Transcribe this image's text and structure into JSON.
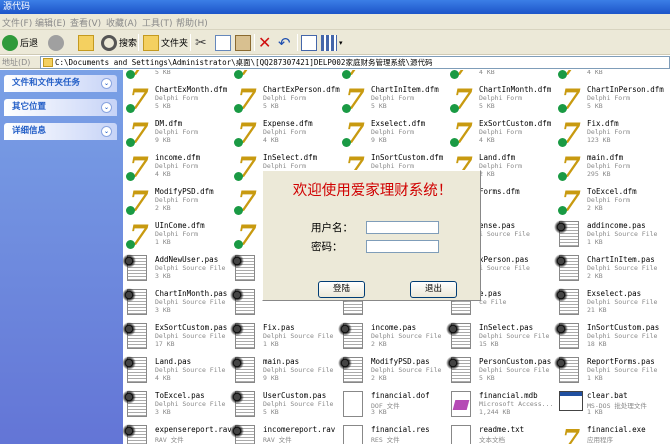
{
  "window": {
    "title": "源代码"
  },
  "menu": [
    "文件(F)",
    "编辑(E)",
    "查看(V)",
    "收藏(A)",
    "工具(T)",
    "帮助(H)"
  ],
  "toolbar": {
    "back": "后退",
    "search": "搜索",
    "folders": "文件夹"
  },
  "address": {
    "label": "地址(D)",
    "path": "C:\\Documents and Settings\\Administrator\\桌面\\[QQ287307421]DELP002家庭财务管理系统\\源代码"
  },
  "sidebar": {
    "panels": [
      {
        "title": "文件和文件夹任务"
      },
      {
        "title": "其它位置"
      },
      {
        "title": "详细信息"
      }
    ]
  },
  "files": [
    {
      "name": "",
      "type": "Delphi Form",
      "size": "5 KB",
      "icon": "delphi-form-icon"
    },
    {
      "name": "",
      "type": "",
      "size": "",
      "icon": "delphi-form-icon"
    },
    {
      "name": "",
      "type": "",
      "size": "",
      "icon": "delphi-form-icon"
    },
    {
      "name": "",
      "type": "",
      "size": "4 KB",
      "icon": "delphi-form-icon"
    },
    {
      "name": "",
      "type": "",
      "size": "4 KB",
      "icon": "delphi-form-icon"
    },
    {
      "name": "ChartExMonth.dfm",
      "type": "Delphi Form",
      "size": "5 KB",
      "icon": "delphi-form-icon"
    },
    {
      "name": "ChartExPerson.dfm",
      "type": "Delphi Form",
      "size": "5 KB",
      "icon": "delphi-form-icon"
    },
    {
      "name": "ChartInItem.dfm",
      "type": "Delphi Form",
      "size": "5 KB",
      "icon": "delphi-form-icon"
    },
    {
      "name": "ChartInMonth.dfm",
      "type": "Delphi Form",
      "size": "5 KB",
      "icon": "delphi-form-icon"
    },
    {
      "name": "ChartInPerson.dfm",
      "type": "Delphi Form",
      "size": "5 KB",
      "icon": "delphi-form-icon"
    },
    {
      "name": "DM.dfm",
      "type": "Delphi Form",
      "size": "9 KB",
      "icon": "delphi-form-icon"
    },
    {
      "name": "Expense.dfm",
      "type": "Delphi Form",
      "size": "4 KB",
      "icon": "delphi-form-icon"
    },
    {
      "name": "Exselect.dfm",
      "type": "Delphi Form",
      "size": "9 KB",
      "icon": "delphi-form-icon"
    },
    {
      "name": "ExSortCustom.dfm",
      "type": "Delphi Form",
      "size": "4 KB",
      "icon": "delphi-form-icon"
    },
    {
      "name": "Fix.dfm",
      "type": "Delphi Form",
      "size": "123 KB",
      "icon": "delphi-form-icon"
    },
    {
      "name": "income.dfm",
      "type": "Delphi Form",
      "size": "4 KB",
      "icon": "delphi-form-icon"
    },
    {
      "name": "InSelect.dfm",
      "type": "Delphi Form",
      "size": "9 KB",
      "icon": "delphi-form-icon"
    },
    {
      "name": "InSortCustom.dfm",
      "type": "Delphi Form",
      "size": "4 KB",
      "icon": "delphi-form-icon"
    },
    {
      "name": "Land.dfm",
      "type": "Delphi Form",
      "size": "2 KB",
      "icon": "delphi-form-icon"
    },
    {
      "name": "main.dfm",
      "type": "Delphi Form",
      "size": "295 KB",
      "icon": "delphi-form-icon"
    },
    {
      "name": "ModifyPSD.dfm",
      "type": "Delphi Form",
      "size": "2 KB",
      "icon": "delphi-form-icon"
    },
    {
      "name": "",
      "type": "",
      "size": "",
      "icon": "delphi-form-icon"
    },
    {
      "name": "",
      "type": "",
      "size": "",
      "icon": "delphi-form-icon"
    },
    {
      "name": "Forms.dfm",
      "type": "",
      "size": "",
      "icon": "delphi-form-icon"
    },
    {
      "name": "ToExcel.dfm",
      "type": "Delphi Form",
      "size": "2 KB",
      "icon": "delphi-form-icon"
    },
    {
      "name": "UInCome.dfm",
      "type": "Delphi Form",
      "size": "1 KB",
      "icon": "delphi-form-icon"
    },
    {
      "name": "",
      "type": "",
      "size": "",
      "icon": "delphi-form-icon"
    },
    {
      "name": "",
      "type": "",
      "size": "",
      "icon": "delphi-form-icon"
    },
    {
      "name": "ense.pas",
      "type": "i Source File",
      "size": "",
      "icon": "pascal-source-icon"
    },
    {
      "name": "addincome.pas",
      "type": "Delphi Source File",
      "size": "1 KB",
      "icon": "pascal-source-icon"
    },
    {
      "name": "AddNewUser.pas",
      "type": "Delphi Source File",
      "size": "3 KB",
      "icon": "pascal-source-icon"
    },
    {
      "name": "",
      "type": "",
      "size": "",
      "icon": "pascal-source-icon"
    },
    {
      "name": "",
      "type": "",
      "size": "",
      "icon": "pascal-source-icon"
    },
    {
      "name": "xPerson.pas",
      "type": "i Source File",
      "size": "",
      "icon": "pascal-source-icon"
    },
    {
      "name": "ChartInItem.pas",
      "type": "Delphi Source File",
      "size": "2 KB",
      "icon": "pascal-source-icon"
    },
    {
      "name": "ChartInMonth.pas",
      "type": "Delphi Source File",
      "size": "3 KB",
      "icon": "pascal-source-icon"
    },
    {
      "name": "",
      "type": "",
      "size": "",
      "icon": "pascal-source-icon"
    },
    {
      "name": "",
      "type": "",
      "size": "",
      "icon": "pascal-source-icon"
    },
    {
      "name": "e.pas",
      "type": "ce File",
      "size": "",
      "icon": "pascal-source-icon"
    },
    {
      "name": "Exselect.pas",
      "type": "Delphi Source File",
      "size": "21 KB",
      "icon": "pascal-source-icon"
    },
    {
      "name": "ExSortCustom.pas",
      "type": "Delphi Source File",
      "size": "17 KB",
      "icon": "pascal-source-icon"
    },
    {
      "name": "Fix.pas",
      "type": "Delphi Source File",
      "size": "1 KB",
      "icon": "pascal-source-icon"
    },
    {
      "name": "income.pas",
      "type": "Delphi Source File",
      "size": "2 KB",
      "icon": "pascal-source-icon"
    },
    {
      "name": "InSelect.pas",
      "type": "Delphi Source File",
      "size": "15 KB",
      "icon": "pascal-source-icon"
    },
    {
      "name": "InSortCustom.pas",
      "type": "Delphi Source File",
      "size": "18 KB",
      "icon": "pascal-source-icon"
    },
    {
      "name": "Land.pas",
      "type": "Delphi Source File",
      "size": "4 KB",
      "icon": "pascal-source-icon"
    },
    {
      "name": "main.pas",
      "type": "Delphi Source File",
      "size": "9 KB",
      "icon": "pascal-source-icon"
    },
    {
      "name": "ModifyPSD.pas",
      "type": "Delphi Source File",
      "size": "2 KB",
      "icon": "pascal-source-icon"
    },
    {
      "name": "PersonCustom.pas",
      "type": "Delphi Source File",
      "size": "5 KB",
      "icon": "pascal-source-icon"
    },
    {
      "name": "ReportForms.pas",
      "type": "Delphi Source File",
      "size": "1 KB",
      "icon": "pascal-source-icon"
    },
    {
      "name": "ToExcel.pas",
      "type": "Delphi Source File",
      "size": "3 KB",
      "icon": "pascal-source-icon"
    },
    {
      "name": "UserCustom.pas",
      "type": "Delphi Source File",
      "size": "5 KB",
      "icon": "pascal-source-icon"
    },
    {
      "name": "financial.dof",
      "type": "DOF 文件",
      "size": "3 KB",
      "icon": "document-icon"
    },
    {
      "name": "financial.mdb",
      "type": "Microsoft Access...",
      "size": "1,244 KB",
      "icon": "access-database-icon"
    },
    {
      "name": "clear.bat",
      "type": "MS-DOS 批处理文件",
      "size": "1 KB",
      "icon": "batch-file-icon"
    },
    {
      "name": "expensereport.rav",
      "type": "RAV 文件",
      "size": "",
      "icon": "pascal-source-icon"
    },
    {
      "name": "incomereport.rav",
      "type": "RAV 文件",
      "size": "",
      "icon": "pascal-source-icon"
    },
    {
      "name": "financial.res",
      "type": "RES 文件",
      "size": "",
      "icon": "document-icon"
    },
    {
      "name": "readme.txt",
      "type": "文本文档",
      "size": "",
      "icon": "text-document-icon"
    },
    {
      "name": "financial.exe",
      "type": "应用程序",
      "size": "",
      "icon": "application-icon"
    }
  ],
  "dialog": {
    "title": "欢迎使用爱家理财系统！",
    "username_label": "用户名：",
    "password_label": "密码：",
    "username_value": "",
    "password_value": "",
    "login_button": "登陆",
    "exit_button": "退出"
  }
}
